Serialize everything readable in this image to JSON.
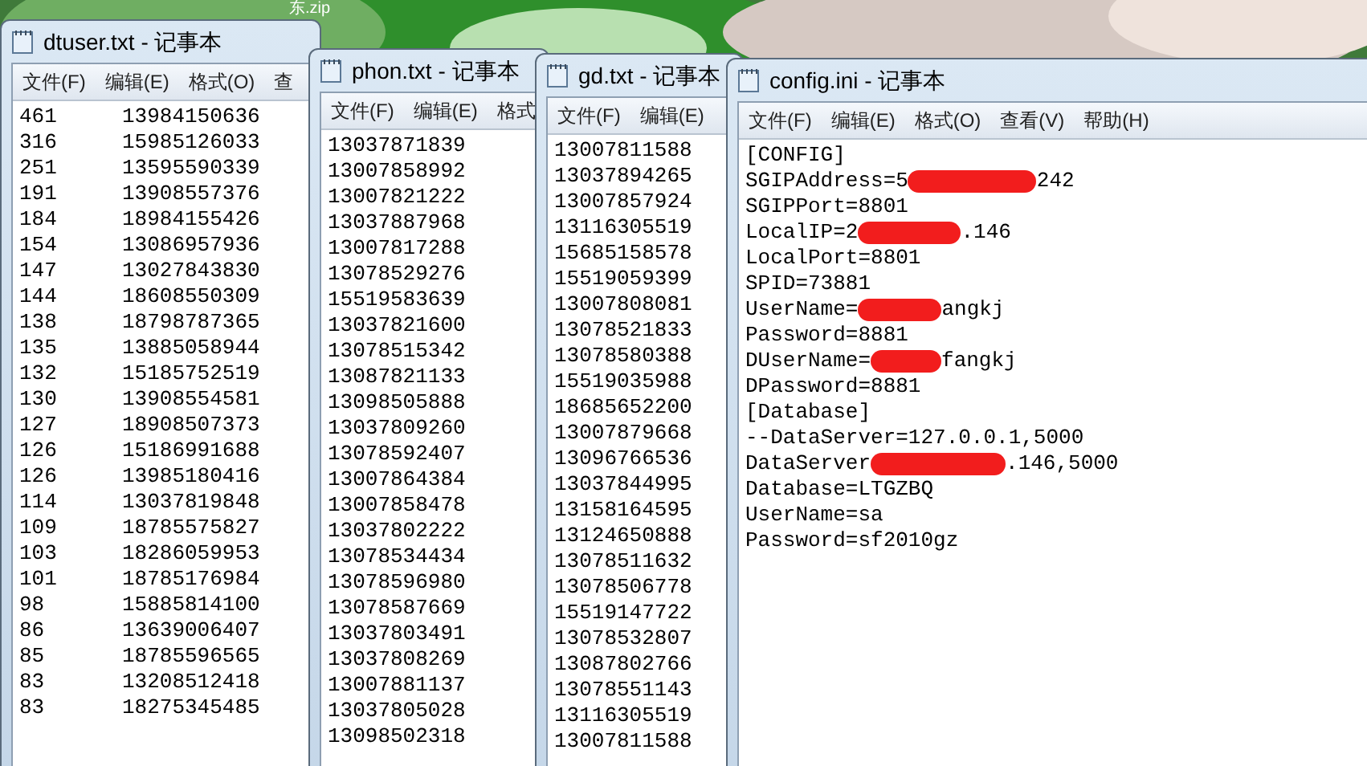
{
  "desktop": {
    "label": "东.zip"
  },
  "windows": [
    {
      "kind": "columns",
      "title": "dtuser.txt - 记事本",
      "menu": [
        "文件(F)",
        "编辑(E)",
        "格式(O)",
        "查"
      ],
      "rows": [
        [
          "461",
          "13984150636"
        ],
        [
          "316",
          "15985126033"
        ],
        [
          "251",
          "13595590339"
        ],
        [
          "191",
          "13908557376"
        ],
        [
          "184",
          "18984155426"
        ],
        [
          "154",
          "13086957936"
        ],
        [
          "147",
          "13027843830"
        ],
        [
          "144",
          "18608550309"
        ],
        [
          "138",
          "18798787365"
        ],
        [
          "135",
          "13885058944"
        ],
        [
          "132",
          "15185752519"
        ],
        [
          "130",
          "13908554581"
        ],
        [
          "127",
          "18908507373"
        ],
        [
          "126",
          "15186991688"
        ],
        [
          "126",
          "13985180416"
        ],
        [
          "114",
          "13037819848"
        ],
        [
          "109",
          "18785575827"
        ],
        [
          "103",
          "18286059953"
        ],
        [
          "101",
          "18785176984"
        ],
        [
          "98",
          "15885814100"
        ],
        [
          "86",
          "13639006407"
        ],
        [
          "85",
          "18785596565"
        ],
        [
          "83",
          "13208512418"
        ],
        [
          "83",
          "18275345485"
        ]
      ]
    },
    {
      "kind": "plain",
      "title": "phon.txt - 记事本",
      "menu": [
        "文件(F)",
        "编辑(E)",
        "格式"
      ],
      "lines": [
        "13037871839",
        "13007858992",
        "13007821222",
        "13037887968",
        "13007817288",
        "13078529276",
        "15519583639",
        "13037821600",
        "13078515342",
        "13087821133",
        "13098505888",
        "13037809260",
        "13078592407",
        "13007864384",
        "13007858478",
        "13037802222",
        "13078534434",
        "13078596980",
        "13078587669",
        "13037803491",
        "13037808269",
        "13007881137",
        "13037805028",
        "13098502318"
      ]
    },
    {
      "kind": "plain",
      "title": "gd.txt - 记事本",
      "menu": [
        "文件(F)",
        "编辑(E)"
      ],
      "lines": [
        "13007811588",
        "13037894265",
        "13007857924",
        "13116305519",
        "15685158578",
        "15519059399",
        "13007808081",
        "13078521833",
        "13078580388",
        "15519035988",
        "18685652200",
        "13007879668",
        "13096766536",
        "13037844995",
        "13158164595",
        "13124650888",
        "13078511632",
        "13078506778",
        "15519147722",
        "13078532807",
        "13087802766",
        "13078551143",
        "13116305519",
        "13007811588"
      ]
    },
    {
      "kind": "config",
      "title": "config.ini - 记事本",
      "menu": [
        "文件(F)",
        "编辑(E)",
        "格式(O)",
        "查看(V)",
        "帮助(H)"
      ],
      "entries": [
        {
          "text": "[CONFIG]",
          "redacted": false
        },
        {
          "text": "SGIPAddress=5",
          "redacted": true,
          "after": "242"
        },
        {
          "text": "SGIPPort=8801",
          "redacted": false
        },
        {
          "text": "LocalIP=2",
          "redacted": true,
          "after": ".146"
        },
        {
          "text": "LocalPort=8801",
          "redacted": false
        },
        {
          "text": "SPID=73881",
          "redacted": false
        },
        {
          "text": "UserName=",
          "redacted": true,
          "after": "angkj"
        },
        {
          "text": "Password=8881",
          "redacted": false
        },
        {
          "text": "DUserName=",
          "redacted": true,
          "after": "fangkj"
        },
        {
          "text": "DPassword=8881",
          "redacted": false
        },
        {
          "text": "[Database]",
          "redacted": false
        },
        {
          "text": "--DataServer=127.0.0.1,5000",
          "redacted": false
        },
        {
          "text": "DataServer",
          "redacted": true,
          "after": ".146,5000"
        },
        {
          "text": "Database=LTGZBQ",
          "redacted": false
        },
        {
          "text": "UserName=sa",
          "redacted": false
        },
        {
          "text": "Password=sf2010gz",
          "redacted": false
        }
      ]
    }
  ]
}
